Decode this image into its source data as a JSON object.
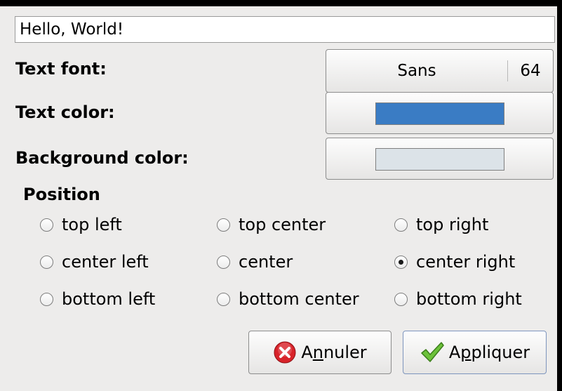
{
  "text_entry": {
    "value": "Hello, World!"
  },
  "font": {
    "label": "Text font:",
    "family": "Sans",
    "size": "64"
  },
  "text_color": {
    "label": "Text color:",
    "swatch": "#3a7cc4"
  },
  "background_color": {
    "label": "Background color:",
    "swatch": "#dce3e8"
  },
  "position": {
    "title": "Position",
    "selected": "center right",
    "options": [
      "top left",
      "top center",
      "top right",
      "center left",
      "center",
      "center right",
      "bottom left",
      "bottom center",
      "bottom right"
    ]
  },
  "buttons": {
    "cancel": {
      "label_pre": "A",
      "label_mnemonic": "n",
      "label_post": "nuler",
      "icon": "cancel-x-icon",
      "icon_color": "#d8232a"
    },
    "apply": {
      "label_pre": "A",
      "label_mnemonic": "p",
      "label_post": "pliquer",
      "icon": "checkmark-icon",
      "icon_color": "#6cc23a"
    }
  }
}
